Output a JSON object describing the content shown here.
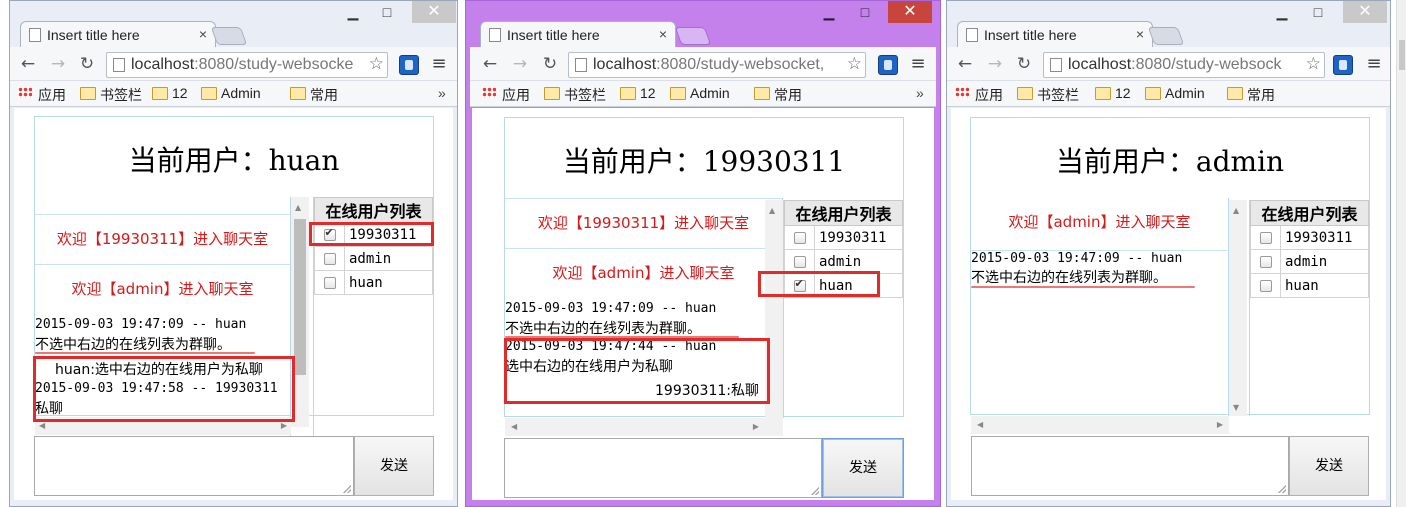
{
  "windows": [
    {
      "tab_title": "Insert title here",
      "url_host": "localhost",
      "url_rest": ":8080/study-websocke",
      "bookmarks": [
        "应用",
        "书签栏",
        "12",
        "Admin",
        "常用"
      ],
      "more": "»",
      "current_user": "当前用户：huan",
      "system_messages": [
        "欢迎【19930311】进入聊天室",
        "欢迎【admin】进入聊天室"
      ],
      "messages": [
        {
          "header": "2015-09-03 19:47:09 -- huan",
          "text": "不选中右边的在线列表为群聊。"
        },
        {
          "header": "",
          "text": "huan:选中右边的在线用户为私聊"
        },
        {
          "header": "2015-09-03 19:47:58 -- 19930311",
          "text": "私聊"
        }
      ],
      "user_list_title": "在线用户列表",
      "users": [
        {
          "name": "19930311",
          "checked": true
        },
        {
          "name": "admin",
          "checked": false
        },
        {
          "name": "huan",
          "checked": false
        }
      ],
      "send_label": "发送"
    },
    {
      "tab_title": "Insert title here",
      "url_host": "localhost",
      "url_rest": ":8080/study-websocket,",
      "bookmarks": [
        "应用",
        "书签栏",
        "12",
        "Admin",
        "常用"
      ],
      "more": "»",
      "current_user": "当前用户：19930311",
      "system_messages": [
        "欢迎【19930311】进入聊天室",
        "欢迎【admin】进入聊天室"
      ],
      "messages": [
        {
          "header": "2015-09-03 19:47:09 -- huan",
          "text": "不选中右边的在线列表为群聊。"
        },
        {
          "header": "2015-09-03 19:47:44 -- huan",
          "text": "选中右边的在线用户为私聊"
        },
        {
          "header": "",
          "text": "19930311:私聊"
        }
      ],
      "user_list_title": "在线用户列表",
      "users": [
        {
          "name": "19930311",
          "checked": false
        },
        {
          "name": "admin",
          "checked": false
        },
        {
          "name": "huan",
          "checked": true
        }
      ],
      "send_label": "发送"
    },
    {
      "tab_title": "Insert title here",
      "url_host": "localhost",
      "url_rest": ":8080/study-websock",
      "bookmarks": [
        "应用",
        "书签栏",
        "12",
        "Admin",
        "常用"
      ],
      "more": "»",
      "current_user": "当前用户：admin",
      "system_messages": [
        "欢迎【admin】进入聊天室"
      ],
      "messages": [
        {
          "header": "2015-09-03 19:47:09 -- huan",
          "text": "不选中右边的在线列表为群聊。"
        }
      ],
      "user_list_title": "在线用户列表",
      "users": [
        {
          "name": "19930311",
          "checked": false
        },
        {
          "name": "admin",
          "checked": false
        },
        {
          "name": "huan",
          "checked": false
        }
      ],
      "send_label": "发送"
    }
  ],
  "colors": {
    "system_message": "#d71919",
    "highlight_box": "#e12b2b",
    "active_frame": "#c481ec"
  },
  "icons": [
    "page-icon",
    "back-arrow-icon",
    "forward-arrow-icon",
    "reload-icon",
    "bookmark-star-icon",
    "extension-icon",
    "menu-icon",
    "folder-icon",
    "apps-grid-icon",
    "checkbox-icon",
    "minimize-icon",
    "maximize-icon",
    "close-icon"
  ]
}
